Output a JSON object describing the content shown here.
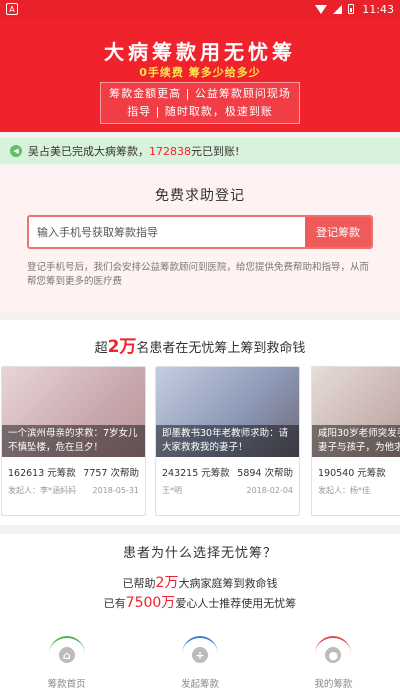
{
  "status_bar": {
    "time": "11:43"
  },
  "hero": {
    "title": "大病筹款用无忧筹",
    "subtitle": "0手续费 筹多少给多少",
    "box_line1": "筹款金额更高 | 公益筹款顾问现场",
    "box_line2": "指导 | 随时取款，极速到账"
  },
  "notice": {
    "prefix": "吴占美已完成大病筹款，",
    "amount": "172838",
    "suffix": "元已到账!"
  },
  "register": {
    "title": "免费求助登记",
    "input_placeholder": "输入手机号获取筹款指导",
    "button_label": "登记筹款",
    "description": "登记手机号后，我们会安排公益筹款顾问到医院，给您提供免费帮助和指导，从而帮您筹到更多的医疗费"
  },
  "stories": {
    "title_prefix": "超",
    "title_number": "2万",
    "title_suffix": "名患者在无忧筹上筹到救命钱",
    "cards": [
      {
        "caption": "一个滨州母亲的求救：7岁女儿不慎坠楼，危在旦夕！",
        "amount": "162613 元筹款",
        "helps": "7757 次帮助",
        "initiator": "发起人：李*涵妈妈",
        "date": "2018-05-31",
        "img_color": "#d6c1c4"
      },
      {
        "caption": "即墨教书30年老教师求助：请大家救救我的妻子！",
        "amount": "243215 元筹款",
        "helps": "5894 次帮助",
        "initiator": "王*明",
        "date": "2018-02-04",
        "img_color": "#a9b3c8"
      },
      {
        "caption": "咸阳30岁老师突发手术，护士妻子与孩子，为他求助",
        "amount": "190540 元筹款",
        "helps": "",
        "initiator": "发起人：杨*佳",
        "date": "",
        "img_color": "#c9b8b5"
      }
    ]
  },
  "why": {
    "title": "患者为什么选择无忧筹？",
    "line1_prefix": "已帮助",
    "line1_number": "2万",
    "line1_suffix": "大病家庭筹到救命钱",
    "line2_prefix": "已有",
    "line2_number": "7500万",
    "line2_suffix": "爱心人士推荐使用无忧筹"
  },
  "tabbar": {
    "tabs": [
      {
        "label": "筹款首页",
        "icon": "home-icon"
      },
      {
        "label": "发起筹款",
        "icon": "add-icon"
      },
      {
        "label": "我的筹款",
        "icon": "user-icon"
      }
    ]
  }
}
